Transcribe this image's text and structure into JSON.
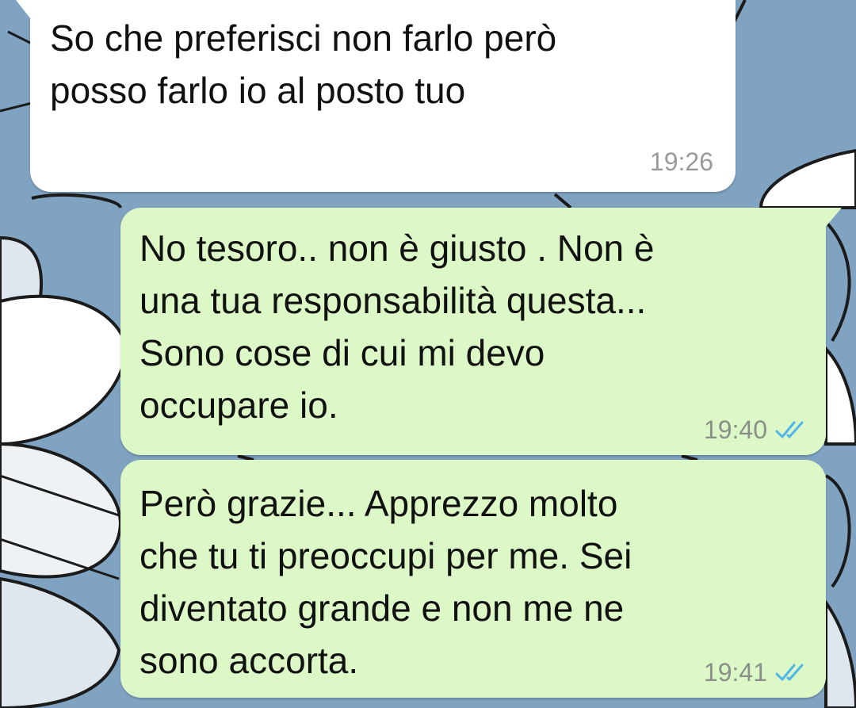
{
  "colors": {
    "wallpaper": "#7fa3c1",
    "incoming_bubble": "#ffffff",
    "outgoing_bubble": "#dcf8c6",
    "timestamp": "#8a8f8a",
    "read_ticks": "#4fb6ec"
  },
  "messages": [
    {
      "direction": "incoming",
      "text": "So che preferisci non farlo però\nposso farlo io al posto tuo",
      "time": "19:26"
    },
    {
      "direction": "outgoing",
      "text": "No tesoro.. non è giusto . Non è\nuna tua responsabilità questa...\nSono cose di cui mi devo\noccupare io.",
      "time": "19:40",
      "status_icon": "double-check-read-icon"
    },
    {
      "direction": "outgoing",
      "text": "Però grazie... Apprezzo molto\nche tu ti preoccupi per me. Sei\ndiventato grande e non me ne\nsono accorta.",
      "time": "19:41",
      "status_icon": "double-check-read-icon"
    }
  ]
}
